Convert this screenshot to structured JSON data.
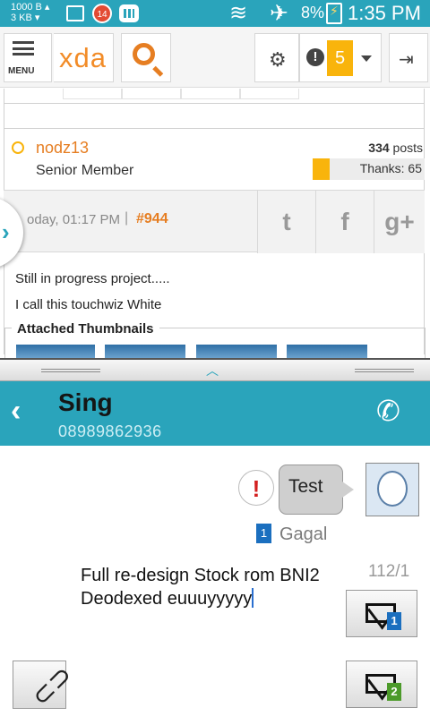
{
  "status_bar": {
    "net_up": "1000 B ▴",
    "net_down": "3 KB ▾",
    "notification_count": "14",
    "battery_percent": "8%",
    "time": "1:35 PM"
  },
  "xda": {
    "menu_label": "MENU",
    "logo": "xda",
    "alert_count": "5",
    "post": {
      "username": "nodz13",
      "user_title": "Senior Member",
      "posts_count": "334",
      "posts_label": "posts",
      "thanks_label": "Thanks: 65",
      "thanks_fill_fraction": 0.15,
      "time": "oday, 01:17 PM",
      "separator": "|",
      "post_number": "#944",
      "body_line_1": "Still in progress project.....",
      "body_line_2": "I call this touchwiz White",
      "attached_label": "Attached Thumbnails"
    },
    "share": {
      "twitter": "t",
      "facebook": "f",
      "google_plus": "g+"
    }
  },
  "messages": {
    "contact_name": "Sing",
    "contact_number": "08989862936",
    "sent_message": "Test",
    "failed_icon": "!",
    "sim_label": "1",
    "status": "Gagal",
    "compose_text": "Full re-design Stock rom BNI2 Deodexed euuuyyyyy",
    "char_count": "112/1",
    "send_sim1_label": "1",
    "send_sim2_label": "2"
  },
  "colors": {
    "status_bar": "#2aa4bb",
    "accent_orange": "#e67e22",
    "badge_yellow": "#f9b40c",
    "fail_red": "#d32020",
    "sim1_blue": "#1b6fbf",
    "sim2_green": "#4c9a2a"
  },
  "icons": [
    "gallery-icon",
    "bbm-icon",
    "wifi-icon",
    "airplane-icon",
    "battery-icon",
    "menu-icon",
    "search-icon",
    "gear-icon",
    "alert-icon",
    "logout-icon",
    "twitter-icon",
    "facebook-icon",
    "google-plus-icon",
    "back-icon",
    "call-icon",
    "avatar-icon",
    "send-icon",
    "paperclip-icon"
  ]
}
